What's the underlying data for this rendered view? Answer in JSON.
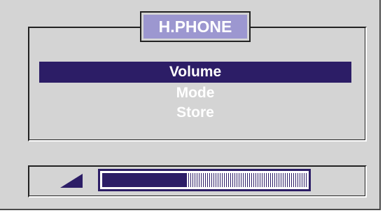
{
  "title": "H.PHONE",
  "menu": {
    "items": [
      {
        "label": "Volume",
        "selected": true
      },
      {
        "label": "Mode",
        "selected": false
      },
      {
        "label": "Store",
        "selected": false
      }
    ]
  },
  "level": {
    "icon": "volume-ramp-icon",
    "fraction": 0.41
  },
  "colors": {
    "screen_bg": "#d4d4d4",
    "title_bg": "#9c97d0",
    "selection": "#2c1d66",
    "text": "#ffffff"
  }
}
